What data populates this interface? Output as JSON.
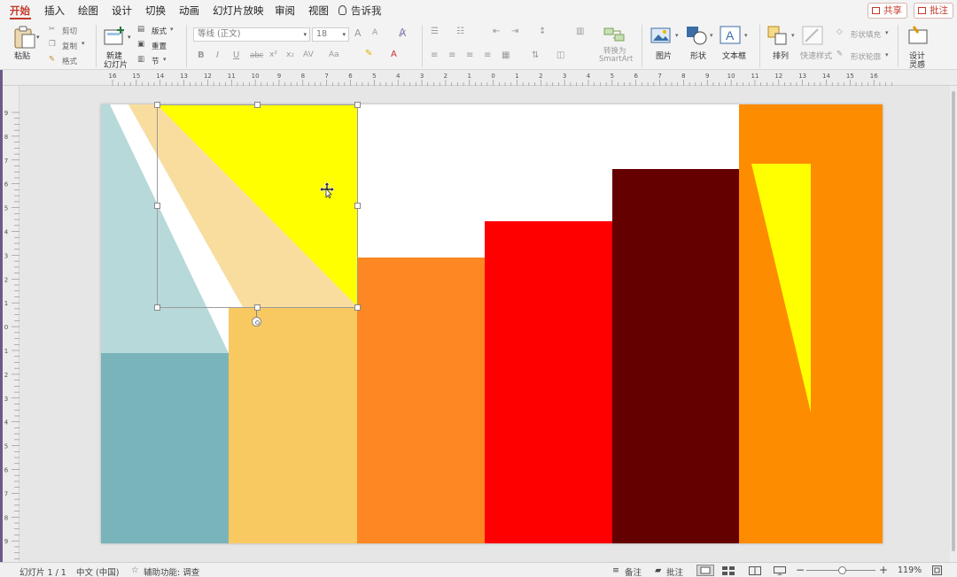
{
  "tabs": [
    "开始",
    "插入",
    "绘图",
    "设计",
    "切换",
    "动画",
    "幻灯片放映",
    "审阅",
    "视图"
  ],
  "active_tab": "开始",
  "tell_me": "告诉我",
  "share_label": "共享",
  "comments_label": "批注",
  "clipboard": {
    "paste_label": "粘贴",
    "cut_label": "剪切",
    "copy_label": "复制",
    "format_label": "格式"
  },
  "slides_group": {
    "new_slide_label": "新建\n幻灯片",
    "new_slide_line1": "新建",
    "new_slide_line2": "幻灯片",
    "layout_label": "版式",
    "reset_label": "重置",
    "section_label": "节"
  },
  "font": {
    "name_placeholder": "等线 (正文)",
    "size_placeholder": "18",
    "grow": "A",
    "shrink": "A",
    "bold": "B",
    "italic": "I",
    "underline": "U",
    "strike": "abc",
    "superscript": "x²",
    "subscript": "x₂",
    "spacing": "AV",
    "case": "Aa"
  },
  "paragraph": {
    "smartart_line1": "转换为",
    "smartart_line2": "SmartArt"
  },
  "insert_group": {
    "picture_label": "图片",
    "shape_label": "形状",
    "textbox_label": "文本框"
  },
  "drawing_group": {
    "arrange_label": "排列",
    "quick_styles_label": "快速样式",
    "shape_fill_label": "形状填充",
    "shape_outline_label": "形状轮廓"
  },
  "designer": {
    "line1": "设计",
    "line2": "灵感"
  },
  "ruler": {
    "h_labels": [
      "16",
      "15",
      "14",
      "13",
      "12",
      "11",
      "10",
      "9",
      "8",
      "7",
      "6",
      "5",
      "4",
      "3",
      "2",
      "1",
      "0",
      "1",
      "2",
      "3",
      "4",
      "5",
      "6",
      "7",
      "8",
      "9",
      "10",
      "11",
      "12",
      "13",
      "14",
      "15",
      "16"
    ],
    "v_labels": [
      "9",
      "8",
      "7",
      "6",
      "5",
      "4",
      "3",
      "2",
      "1",
      "0",
      "1",
      "2",
      "3",
      "4",
      "5",
      "6",
      "7",
      "8",
      "9"
    ]
  },
  "slide": {
    "colors": {
      "light_teal": "#b7d9d9",
      "dark_teal": "#7ab4bb",
      "peach": "#f9dd9f",
      "light_orange": "#f9c961",
      "yellow": "#ffff00",
      "orange": "#fd8722",
      "red": "#ff0000",
      "maroon": "#650000",
      "dark_orange": "#fd8c00",
      "white": "#ffffff"
    }
  },
  "status": {
    "slide_info": "幻灯片 1 / 1",
    "language": "中文 (中国)",
    "accessibility": "辅助功能: 调查",
    "notes_label": "备注",
    "comments_label": "批注",
    "zoom": "119%"
  }
}
